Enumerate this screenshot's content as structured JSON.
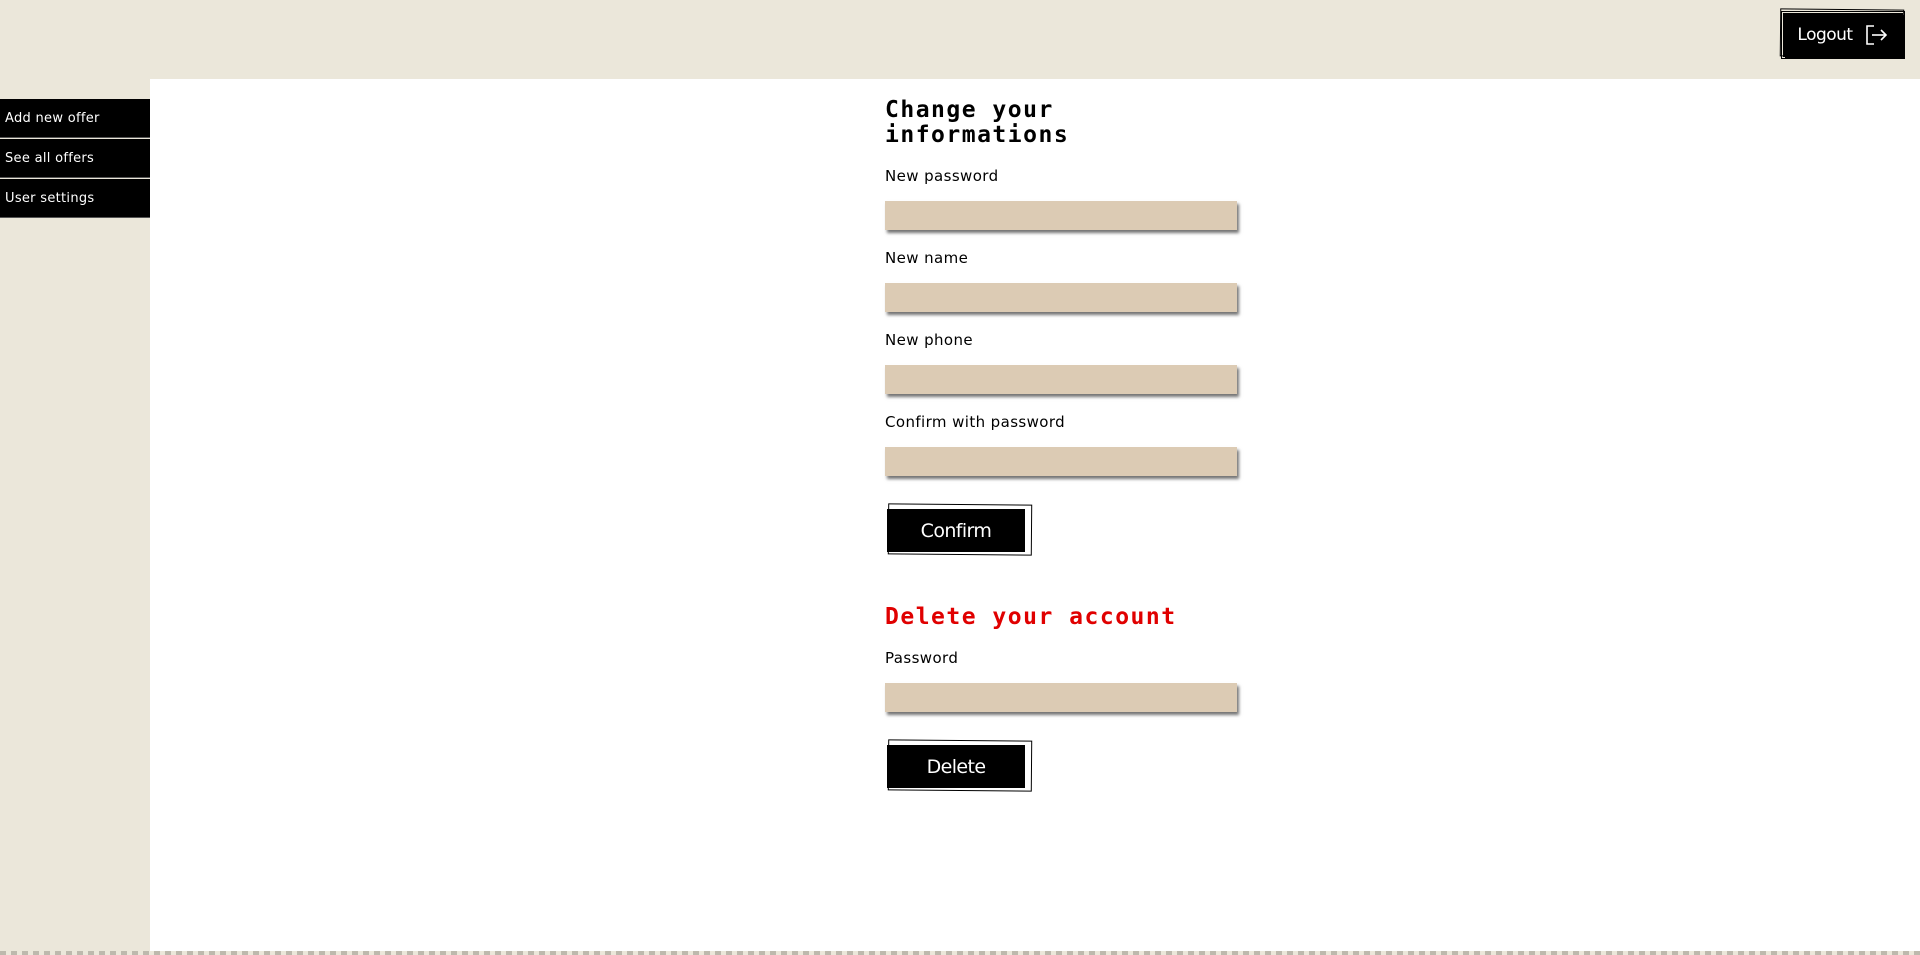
{
  "header": {
    "logout_label": "Logout",
    "logout_icon": "logout-arrow-icon"
  },
  "sidebar": {
    "items": [
      {
        "label": "Add new offer"
      },
      {
        "label": "See all offers"
      },
      {
        "label": "User settings"
      }
    ]
  },
  "change_form": {
    "title": "Change your informations",
    "fields": [
      {
        "label": "New password",
        "value": "",
        "placeholder": ""
      },
      {
        "label": "New name",
        "value": "",
        "placeholder": ""
      },
      {
        "label": "New phone",
        "value": "",
        "placeholder": ""
      },
      {
        "label": "Confirm with password",
        "value": "",
        "placeholder": ""
      }
    ],
    "confirm_label": "Confirm"
  },
  "delete_form": {
    "title": "Delete your account",
    "field": {
      "label": "Password",
      "value": "",
      "placeholder": ""
    },
    "delete_label": "Delete"
  },
  "colors": {
    "background": "#ebe7da",
    "content": "#ffffff",
    "input": "#dccbb4",
    "danger": "#e00000",
    "button": "#000000"
  }
}
